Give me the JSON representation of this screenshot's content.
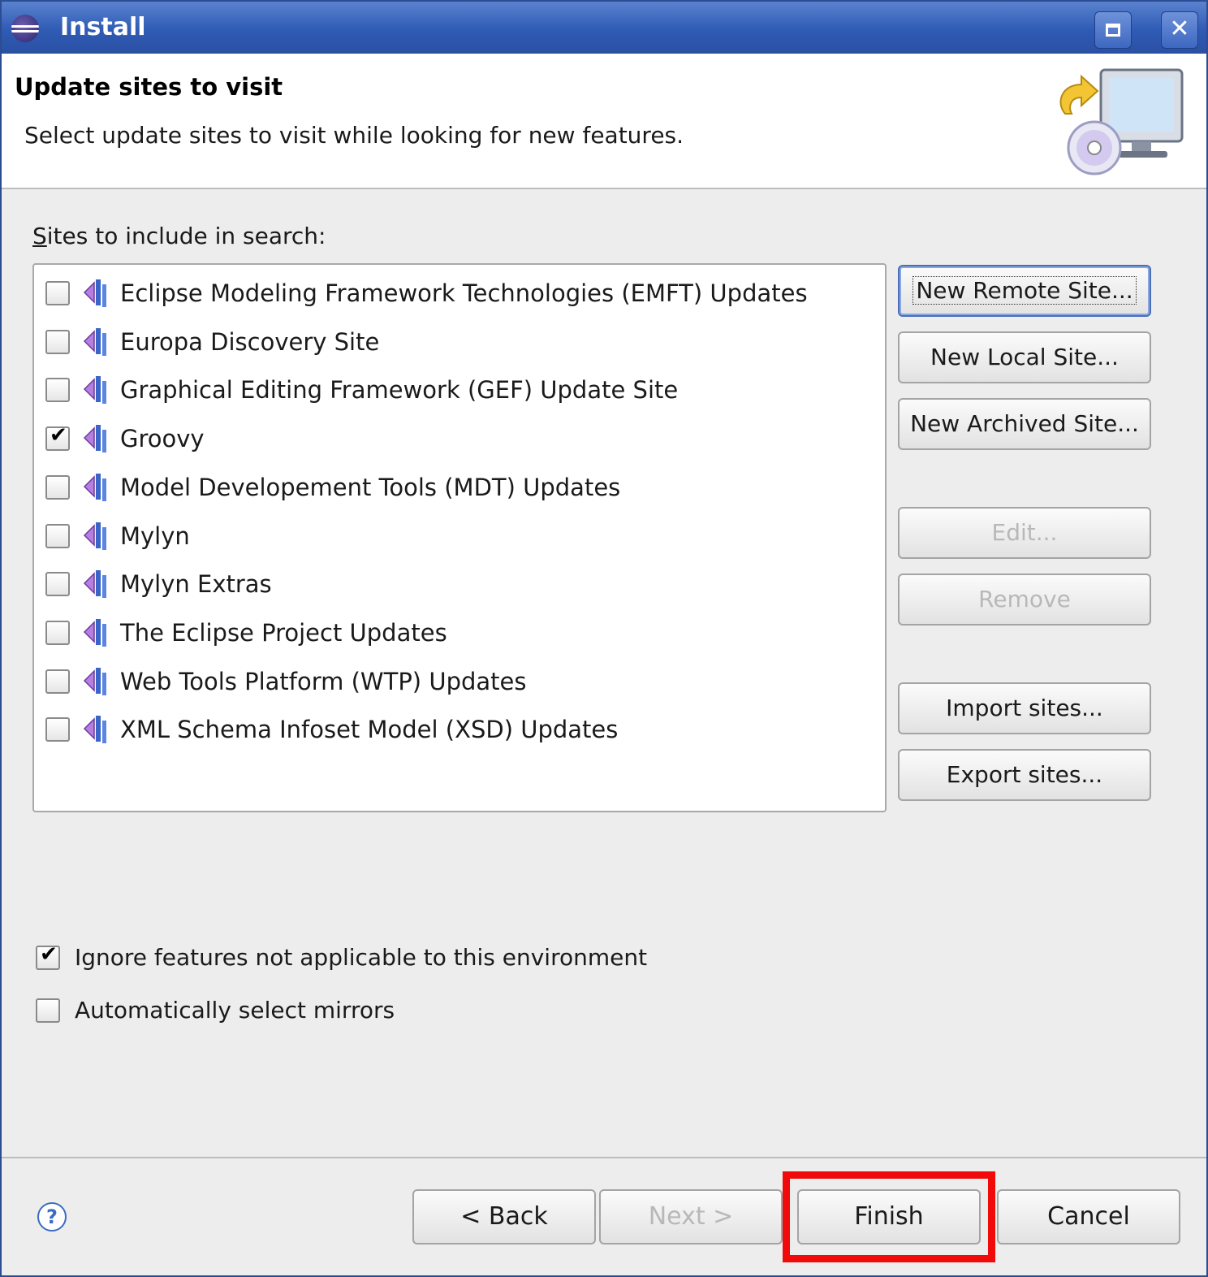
{
  "window": {
    "title": "Install"
  },
  "banner": {
    "title": "Update sites to visit",
    "description": "Select update sites to visit while looking for new features."
  },
  "sites_label": "Sites to include in search:",
  "sites": [
    {
      "label": "Eclipse Modeling Framework Technologies (EMFT) Updates",
      "checked": false
    },
    {
      "label": "Europa Discovery Site",
      "checked": false
    },
    {
      "label": "Graphical Editing Framework (GEF) Update Site",
      "checked": false
    },
    {
      "label": "Groovy",
      "checked": true
    },
    {
      "label": "Model Developement Tools (MDT) Updates",
      "checked": false
    },
    {
      "label": "Mylyn",
      "checked": false
    },
    {
      "label": "Mylyn Extras",
      "checked": false
    },
    {
      "label": "The Eclipse Project Updates",
      "checked": false
    },
    {
      "label": "Web Tools Platform (WTP) Updates",
      "checked": false
    },
    {
      "label": "XML Schema Infoset Model (XSD) Updates",
      "checked": false
    }
  ],
  "buttons": {
    "new_remote": "New Remote Site...",
    "new_local": "New Local Site...",
    "new_archived": "New Archived Site...",
    "edit": "Edit...",
    "remove": "Remove",
    "import": "Import sites...",
    "export": "Export sites..."
  },
  "options": {
    "ignore": {
      "label": "Ignore features not applicable to this environment",
      "checked": true
    },
    "mirrors": {
      "label": "Automatically select mirrors",
      "checked": false
    }
  },
  "nav": {
    "back": "< Back",
    "next": "Next >",
    "finish": "Finish",
    "cancel": "Cancel"
  },
  "colors": {
    "titlebar": "#2f5bb5",
    "highlight": "#f00a0a"
  }
}
